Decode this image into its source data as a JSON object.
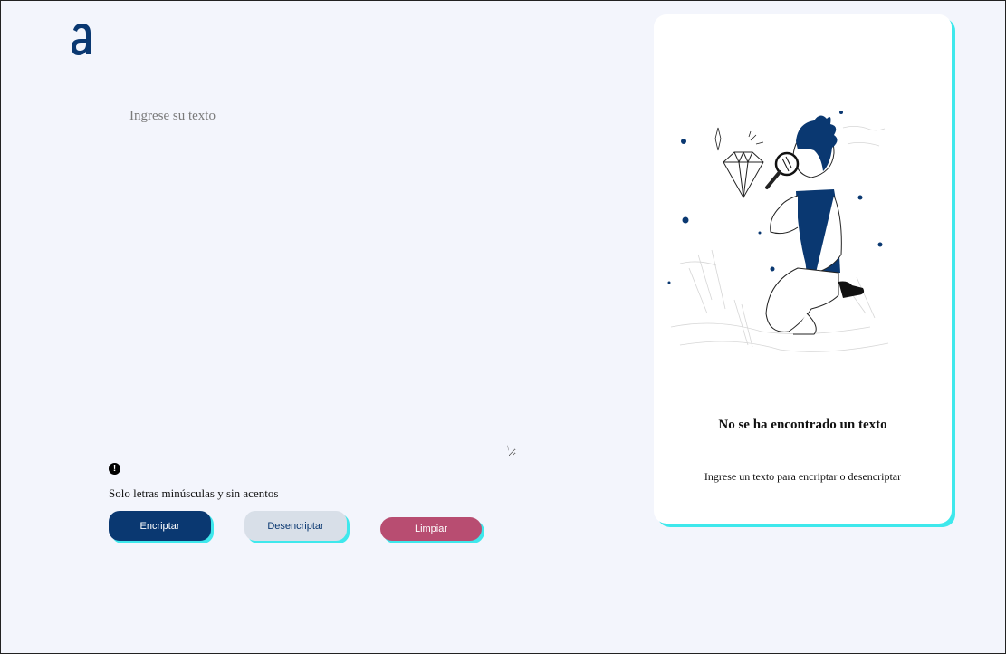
{
  "input": {
    "placeholder": "Ingrese su texto"
  },
  "hint": {
    "icon": "exclamation-circle-icon",
    "text": "Solo letras minúsculas y sin acentos"
  },
  "buttons": {
    "encrypt": "Encriptar",
    "decrypt": "Desencriptar",
    "clear": "Limpiar"
  },
  "output": {
    "title": "No se ha encontrado un texto",
    "subtitle": "Ingrese un texto para encriptar o desencriptar",
    "illustration": "person-with-magnifier-looking-at-diamond"
  },
  "colors": {
    "primary": "#0a3871",
    "accent_shadow": "#3ee8ec",
    "clear_button": "#b84d71",
    "secondary_button": "#d8dfe8",
    "background": "#f3f5fc"
  }
}
